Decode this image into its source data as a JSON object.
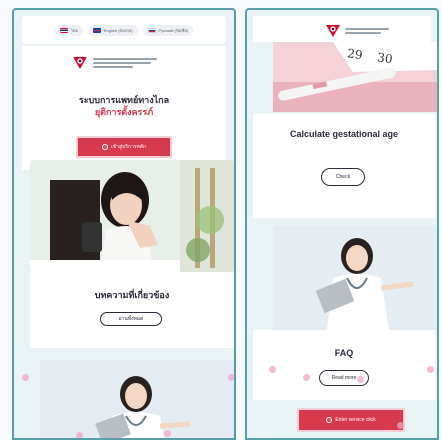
{
  "left_screen": {
    "languages": [
      {
        "flag": "th",
        "label": "ไทย"
      },
      {
        "flag": "uk",
        "label": "English (อังกฤษ)"
      },
      {
        "flag": "ru",
        "label": "Русский (รัสเซีย)"
      }
    ],
    "title": "ระบบการแพทย์ทางไกล",
    "subtitle": "ยุติการตั้งครรภ์",
    "enter_button": "เข้าสู่บริการหลัก",
    "articles_title": "บทความที่เกี่ยวข้อง",
    "read_all_button": "อ่านทั้งหมด"
  },
  "right_screen": {
    "calc_title": "Calculate gestational age",
    "check_button": "Check",
    "faq_title": "FAQ",
    "read_more_button": "Read more",
    "enter_button": "Enter service click"
  },
  "colors": {
    "accent_red": "#d83a4d",
    "frame_teal": "#5a9ea8",
    "dot_pink": "#f0a6c6"
  }
}
